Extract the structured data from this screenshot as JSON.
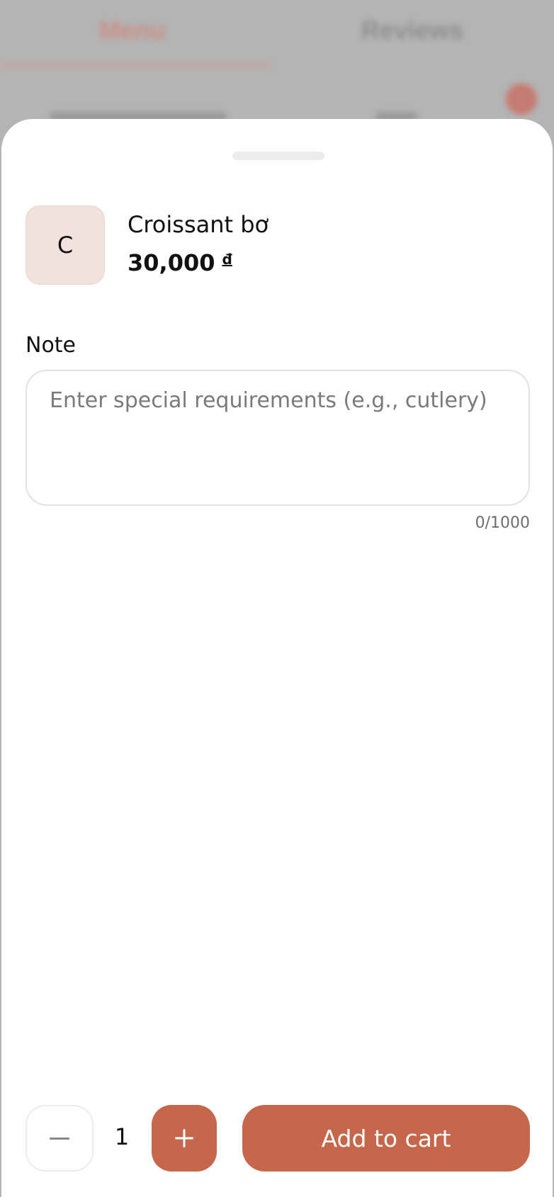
{
  "background": {
    "tabs": [
      "Menu",
      "Reviews"
    ]
  },
  "product": {
    "thumb_letter": "C",
    "name": "Croissant bơ",
    "price": "30,000",
    "currency": "đ"
  },
  "note": {
    "label": "Note",
    "placeholder": "Enter special requirements (e.g., cutlery)",
    "value": "",
    "char_count": "0/1000"
  },
  "footer": {
    "quantity": "1",
    "add_to_cart_label": "Add to cart"
  },
  "colors": {
    "accent": "#c6674b",
    "thumb_bg": "#f2e2de"
  },
  "icons": {
    "decrement": "minus-icon",
    "increment": "plus-icon"
  }
}
